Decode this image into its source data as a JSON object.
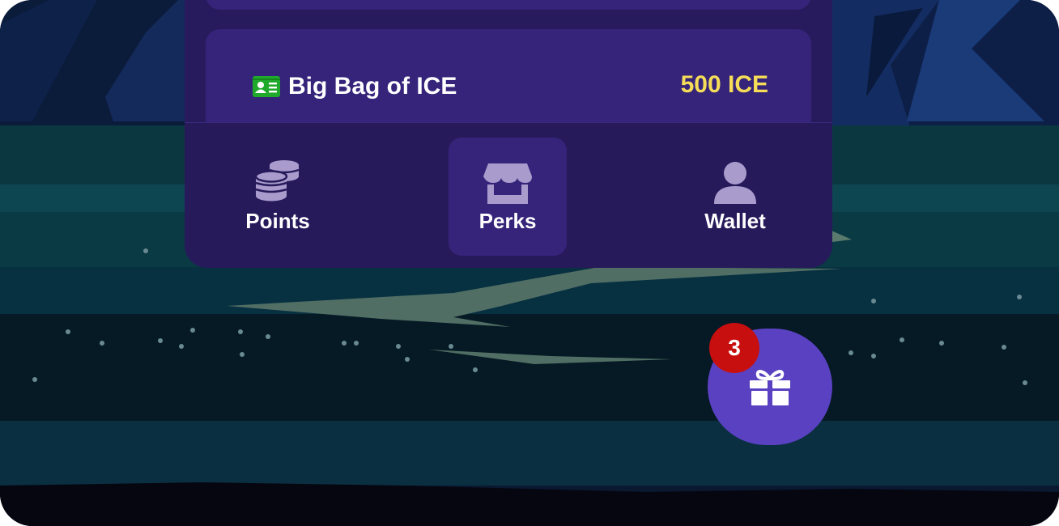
{
  "offer": {
    "icon": "id-card-icon",
    "title": "Big Bag of ICE",
    "price": "500 ICE"
  },
  "nav": {
    "items": [
      {
        "label": "Points",
        "icon": "coins-icon",
        "active": false
      },
      {
        "label": "Perks",
        "icon": "shop-icon",
        "active": true
      },
      {
        "label": "Wallet",
        "icon": "user-icon",
        "active": false
      }
    ]
  },
  "gift": {
    "icon": "gift-icon",
    "badge": "3"
  },
  "colors": {
    "panel": "#271b5d",
    "card": "#35247a",
    "price": "#f5dd57",
    "fab": "#5a41c2",
    "badge": "#c80f0f",
    "icon_id": "#1faa2c",
    "nav_icon": "#a99ccc"
  }
}
